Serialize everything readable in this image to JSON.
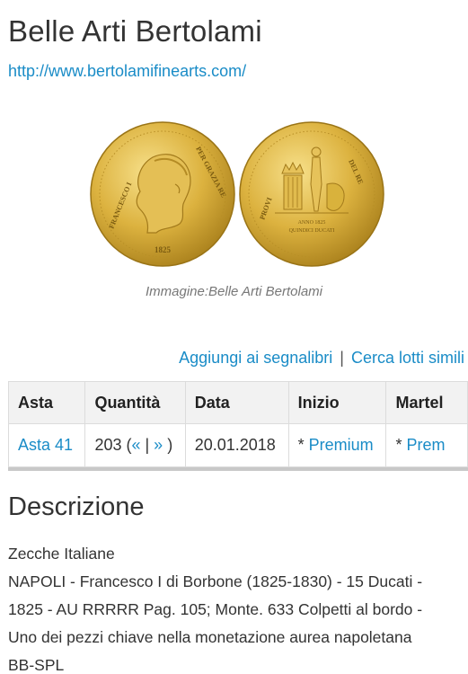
{
  "header": {
    "title": "Belle Arti Bertolami",
    "url": "http://www.bertolamifinearts.com/"
  },
  "image": {
    "caption": "Immagine:Belle Arti Bertolami",
    "obverse_legend_left": "FRANCESCO I",
    "obverse_legend_right": "PER GRAZIA RE",
    "obverse_date": "1825",
    "reverse_legend_left": "PROVI",
    "reverse_legend_right": "DEL RE",
    "reverse_inscription_1": "ANNO 1825",
    "reverse_inscription_2": "QUINDICI DUCATI"
  },
  "actions": {
    "bookmark": "Aggiungi ai segnalibri",
    "separator": "|",
    "similar": "Cerca lotti simili"
  },
  "table": {
    "headers": [
      "Asta",
      "Quantità",
      "Data",
      "Inizio",
      "Martel"
    ],
    "row": {
      "asta": "Asta 41",
      "quantita_num": "203 (",
      "quantita_prev": "«",
      "quantita_sep": " | ",
      "quantita_next": "»",
      "quantita_close": " )",
      "data": "20.01.2018",
      "inizio_prefix": "* ",
      "inizio_link": "Premium",
      "martel_prefix": "* ",
      "martel_link": "Prem"
    }
  },
  "description": {
    "title": "Descrizione",
    "lines": [
      "Zecche Italiane",
      "NAPOLI - Francesco I di Borbone (1825-1830) - 15 Ducati -",
      "1825 - AU RRRRR Pag. 105; Monte. 633 Colpetti al bordo -",
      "Uno dei pezzi chiave nella monetazione aurea napoletana",
      "BB-SPL"
    ]
  },
  "colors": {
    "link": "#1a8cc7",
    "gold": "#d9b23c",
    "header_bg": "#f2f2f2"
  }
}
